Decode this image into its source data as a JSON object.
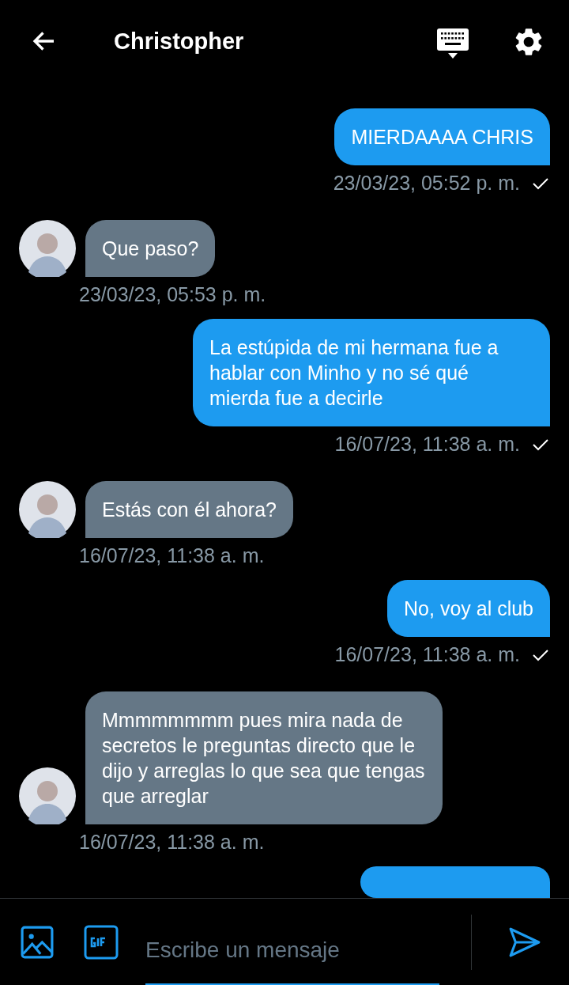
{
  "header": {
    "title": "Christopher"
  },
  "messages": [
    {
      "kind": "sent",
      "text": "MIERDAAAA CHRIS",
      "time": "23/03/23, 05:52 p. m.",
      "read": true
    },
    {
      "kind": "received",
      "text": "Que paso?",
      "time": "23/03/23, 05:53 p. m."
    },
    {
      "kind": "sent",
      "text": "La estúpida de mi hermana fue a hablar con Minho y no sé qué mierda fue a decirle",
      "time": "16/07/23, 11:38 a. m.",
      "read": true
    },
    {
      "kind": "received",
      "text": "Estás con él ahora?",
      "time": "16/07/23, 11:38 a. m."
    },
    {
      "kind": "sent",
      "text": "No, voy al club",
      "time": "16/07/23, 11:38 a. m.",
      "read": true
    },
    {
      "kind": "received",
      "text": "Mmmmmmmm pues mira nada de secretos le preguntas directo que le dijo y arreglas lo que sea que tengas que arreglar",
      "time": "16/07/23, 11:38 a. m."
    }
  ],
  "composer": {
    "placeholder": "Escribe un mensaje"
  }
}
